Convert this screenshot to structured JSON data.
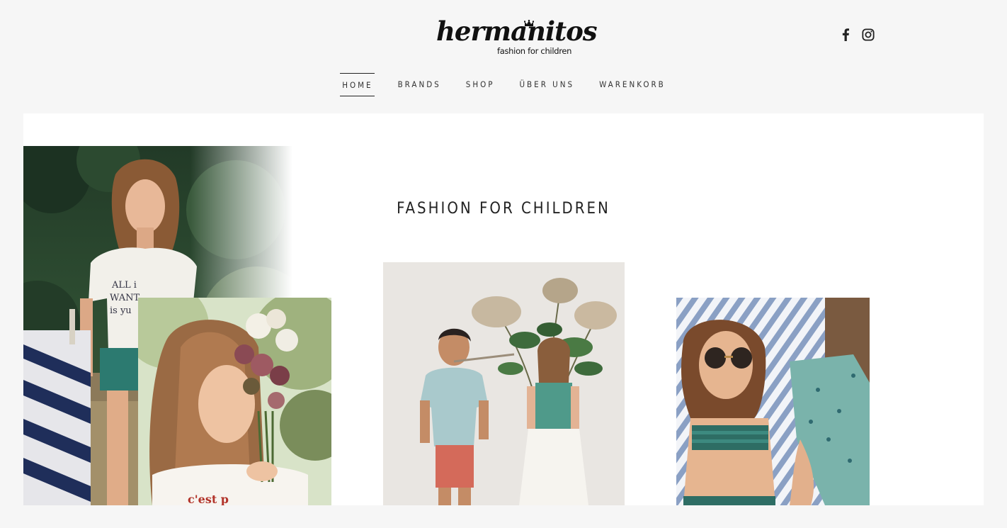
{
  "header": {
    "logo_script": "hermanitos",
    "logo_tagline": "fashion for children",
    "social": [
      {
        "name": "facebook",
        "icon": "facebook-icon"
      },
      {
        "name": "instagram",
        "icon": "instagram-icon"
      }
    ]
  },
  "nav": {
    "items": [
      {
        "label": "HOME",
        "active": true
      },
      {
        "label": "BRANDS",
        "active": false
      },
      {
        "label": "SHOP",
        "active": false
      },
      {
        "label": "ÜBER UNS",
        "active": false
      },
      {
        "label": "WARENKORB",
        "active": false
      }
    ]
  },
  "main": {
    "headline": "FASHION FOR CHILDREN",
    "photos": [
      {
        "name": "hero-photo-girl-forest"
      },
      {
        "name": "photo-girl-flowers"
      },
      {
        "name": "photo-two-children-branches"
      },
      {
        "name": "photo-girl-sunglasses-towel"
      }
    ]
  },
  "colors": {
    "page_background": "#f6f6f6",
    "card_background": "#ffffff",
    "text": "#222222"
  }
}
